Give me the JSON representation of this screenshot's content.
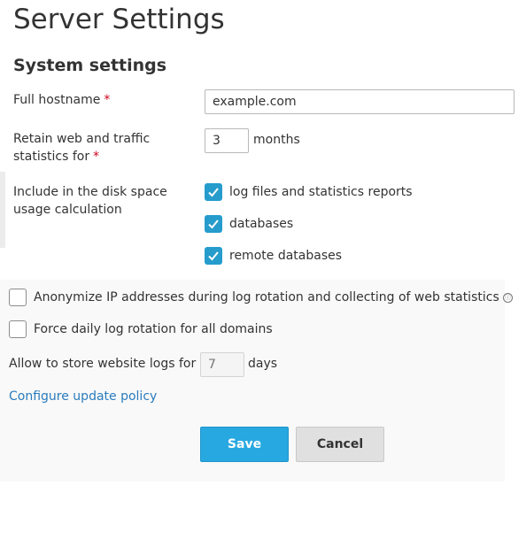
{
  "page": {
    "title": "Server Settings"
  },
  "system_settings": {
    "heading": "System settings",
    "hostname": {
      "label": "Full hostname",
      "required_mark": "*",
      "value": "example.com"
    },
    "retain": {
      "label_line1": "Retain web and traffic",
      "label_line2": "statistics for",
      "required_mark": "*",
      "value": "3",
      "unit": "months"
    },
    "disk_space": {
      "label_line1": "Include in the disk space",
      "label_line2": "usage calculation",
      "options": [
        {
          "label": "log files and statistics reports",
          "checked": true
        },
        {
          "label": "databases",
          "checked": true
        },
        {
          "label": "remote databases",
          "checked": true
        }
      ]
    }
  },
  "log_settings": {
    "anonymize": {
      "label": "Anonymize IP addresses during log rotation and collecting of web statistics",
      "checked": false,
      "info_icon": "ⓘ"
    },
    "force_rotation": {
      "label": "Force daily log rotation for all domains",
      "checked": false
    },
    "store_logs": {
      "label": "Allow to store website logs for",
      "placeholder": "7",
      "unit": "days"
    },
    "update_policy_link": "Configure update policy"
  },
  "actions": {
    "save_label": "Save",
    "cancel_label": "Cancel"
  },
  "colors": {
    "accent": "#28a8e0",
    "checkbox": "#259ccc",
    "link": "#2a7bbd",
    "required": "#d0021b"
  }
}
